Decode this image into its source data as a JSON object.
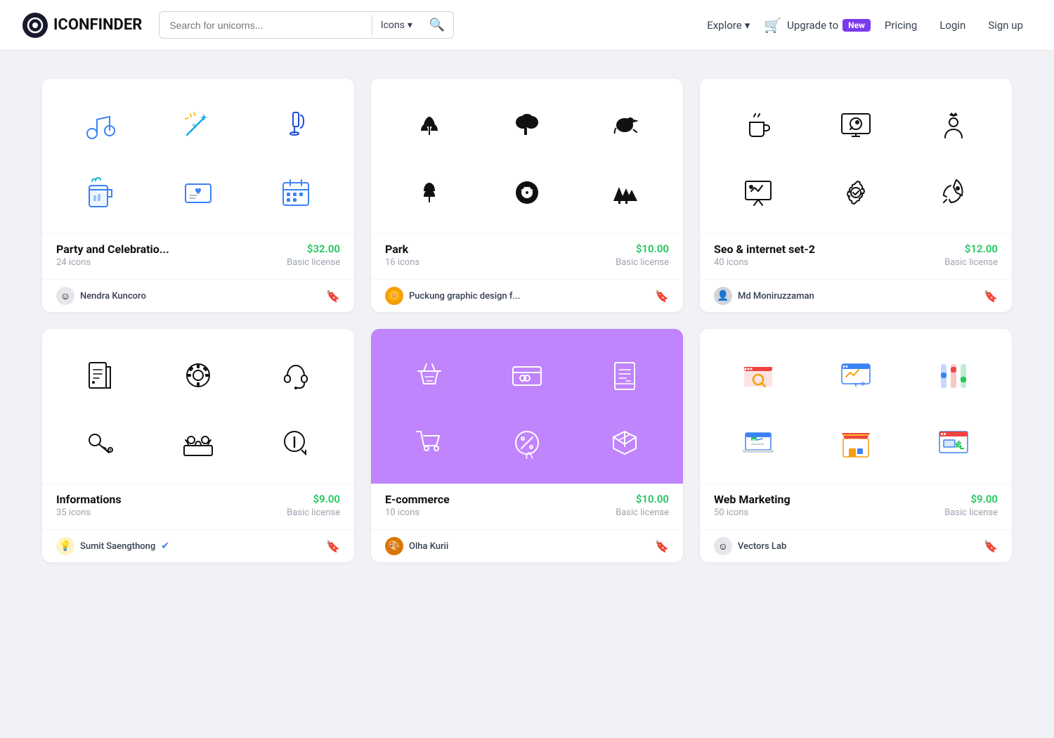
{
  "header": {
    "logo_text": "ICONFINDER",
    "search_placeholder": "Search for unicorns...",
    "search_type_label": "Icons",
    "explore_label": "Explore",
    "upgrade_label": "Upgrade to",
    "new_badge": "New",
    "pricing_label": "Pricing",
    "login_label": "Login",
    "signup_label": "Sign up"
  },
  "cards": [
    {
      "id": "party",
      "title": "Party and Celebratio...",
      "count": "24 icons",
      "price": "$32.00",
      "license": "Basic license",
      "author": "Nendra Kuncoro",
      "bg": "white",
      "color_theme": "blue"
    },
    {
      "id": "park",
      "title": "Park",
      "count": "16 icons",
      "price": "$10.00",
      "license": "Basic license",
      "author": "Puckung graphic design f...",
      "bg": "white",
      "color_theme": "black"
    },
    {
      "id": "seo",
      "title": "Seo & internet set-2",
      "count": "40 icons",
      "price": "$12.00",
      "license": "Basic license",
      "author": "Md Moniruzzaman",
      "bg": "white",
      "color_theme": "black"
    },
    {
      "id": "informations",
      "title": "Informations",
      "count": "35 icons",
      "price": "$9.00",
      "license": "Basic license",
      "author": "Sumit Saengthong",
      "bg": "white",
      "color_theme": "black",
      "verified": true
    },
    {
      "id": "ecommerce",
      "title": "E-commerce",
      "count": "10 icons",
      "price": "$10.00",
      "license": "Basic license",
      "author": "Olha Kurii",
      "bg": "purple",
      "color_theme": "white"
    },
    {
      "id": "webmarketing",
      "title": "Web Marketing",
      "count": "50 icons",
      "price": "$9.00",
      "license": "Basic license",
      "author": "Vectors Lab",
      "bg": "white",
      "color_theme": "color"
    }
  ]
}
